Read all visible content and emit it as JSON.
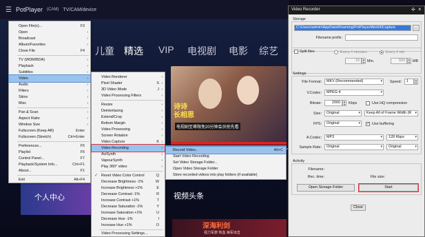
{
  "player": {
    "app_name": "PotPlayer",
    "menu_glyph": "☰",
    "cam_tag": "(CAM)",
    "device": "TV/CAM/device",
    "nav": [
      "儿童",
      "精选",
      "VIP",
      "电视剧",
      "电影",
      "综艺"
    ],
    "poster_title_line1": "诗诗",
    "poster_title_line2": "长相思",
    "poster_subtitle": "电视剧至尊限免20分钟会员抢先看",
    "personal_center": "个人中心",
    "video_headline": "视频头条",
    "promo_title": "深海利剑",
    "promo_subtitle": "强力军旅 热血 海军出击"
  },
  "main_menu": {
    "items": [
      {
        "label": "Open File(s)...",
        "shortcut": "F3"
      },
      {
        "label": "Open",
        "shortcut": "",
        "arrow": true
      },
      {
        "label": "Broadcast",
        "shortcut": "",
        "arrow": true
      },
      {
        "label": "Album/Favorites",
        "shortcut": "",
        "arrow": true
      },
      {
        "label": "Close File",
        "shortcut": "F4"
      },
      {
        "label": "TV (WDM/BDA)",
        "shortcut": "",
        "arrow": true
      },
      {
        "label": "Playback",
        "shortcut": "",
        "arrow": true
      },
      {
        "label": "Subtitles",
        "shortcut": "",
        "arrow": true
      },
      {
        "label": "Video",
        "shortcut": "",
        "arrow": true
      },
      {
        "label": "Audio",
        "shortcut": "",
        "arrow": true
      },
      {
        "label": "Filters",
        "shortcut": "",
        "arrow": true
      },
      {
        "label": "Skins",
        "shortcut": "",
        "arrow": true
      },
      {
        "label": "Misc",
        "shortcut": "",
        "arrow": true
      },
      {
        "label": "Pan & Scan",
        "shortcut": "",
        "arrow": true
      },
      {
        "label": "Aspect Ratio",
        "shortcut": "",
        "arrow": true
      },
      {
        "label": "Window Size",
        "shortcut": "",
        "arrow": true
      },
      {
        "label": "Fullscreen (Keep AR)",
        "shortcut": "Enter"
      },
      {
        "label": "Fullscreen (Stretch)",
        "shortcut": "Ctrl+Enter"
      },
      {
        "label": "Preferences...",
        "shortcut": "F5"
      },
      {
        "label": "Playlist",
        "shortcut": "F6"
      },
      {
        "label": "Control Panel...",
        "shortcut": "F7"
      },
      {
        "label": "Playback/System Info...",
        "shortcut": "Ctrl+F1"
      },
      {
        "label": "About...",
        "shortcut": "F1"
      },
      {
        "label": "Exit",
        "shortcut": "Alt+F4"
      }
    ]
  },
  "video_menu": {
    "items": [
      {
        "label": "Video Renderer",
        "shortcut": "",
        "arrow": true
      },
      {
        "label": "Pixel Shader",
        "shortcut": "S",
        "arrow": true
      },
      {
        "label": "3D Video Mode",
        "shortcut": "J",
        "arrow": true
      },
      {
        "label": "Video Processing Filters",
        "shortcut": "",
        "arrow": true
      },
      {
        "label": "Resize",
        "shortcut": "",
        "arrow": true
      },
      {
        "label": "Deinterlacing",
        "shortcut": "",
        "arrow": true
      },
      {
        "label": "Extend/Crop",
        "shortcut": "",
        "arrow": true
      },
      {
        "label": "Bottom Margin",
        "shortcut": "",
        "arrow": true
      },
      {
        "label": "Video Processing",
        "shortcut": "",
        "arrow": true
      },
      {
        "label": "Screen Rotation",
        "shortcut": "",
        "arrow": true
      },
      {
        "label": "Video Capture",
        "shortcut": "K",
        "arrow": true
      },
      {
        "label": "Video Recording",
        "shortcut": "",
        "arrow": true
      },
      {
        "label": "AviSynth",
        "shortcut": "",
        "arrow": true
      },
      {
        "label": "VapourSynth",
        "shortcut": "",
        "arrow": true
      },
      {
        "label": "Play 360° video",
        "shortcut": "",
        "arrow": true
      },
      {
        "label": "Reset Video Color Control",
        "shortcut": "Q"
      },
      {
        "label": "Decrease Brightness -1%",
        "shortcut": "W"
      },
      {
        "label": "Increase Brightness +1%",
        "shortcut": "E"
      },
      {
        "label": "Decrease Contrast -1%",
        "shortcut": "R"
      },
      {
        "label": "Increase Contrast +1%",
        "shortcut": "T"
      },
      {
        "label": "Decrease Saturation -1%",
        "shortcut": "Y"
      },
      {
        "label": "Increase Saturation +1%",
        "shortcut": "U"
      },
      {
        "label": "Decrease Hue -1%",
        "shortcut": "I"
      },
      {
        "label": "Increase Hue +1%",
        "shortcut": "O"
      },
      {
        "label": "Video Processing Settings...",
        "shortcut": ""
      }
    ]
  },
  "recording_menu": {
    "items": [
      {
        "label": "Record Video...",
        "shortcut": "Alt+C"
      },
      {
        "label": "Start Video Recording",
        "shortcut": ""
      },
      {
        "label": "Set Video Storage Folder...",
        "shortcut": ""
      },
      {
        "label": "Open Video Storage Folder",
        "shortcut": ""
      },
      {
        "label": "Store recorded videos into play folders (if available)",
        "shortcut": ""
      }
    ]
  },
  "recorder": {
    "title": "Video Recorder",
    "pin_glyph": "✢",
    "close_glyph": "×",
    "storage": {
      "group_label": "Storage",
      "path": "C:\\Users\\admin\\AppData\\Roaming\\PotPlayerMini64\\Capture",
      "browse_label": "...",
      "prefix_label": "Filename prefix:",
      "prefix_value": ""
    },
    "split": {
      "label": "Split files",
      "every_minutes": "Every # minutes",
      "every_mb": "Every # mb",
      "minutes_value": "10",
      "minutes_unit": "Min.",
      "mb_value": "500",
      "mb_unit": "MB"
    },
    "settings": {
      "group_label": "Settings",
      "file_format_label": "File Format:",
      "file_format_value": "MKV (Recommended)",
      "speed_label": "Speed:",
      "speed_value": "1",
      "vcodec_label": "V.Codec:",
      "vcodec_value": "MPEG-4",
      "bitrate_label": "Bitrate:",
      "bitrate_value": "2000",
      "bitrate_unit": "Kbps",
      "hq_label": "Use HQ compression",
      "size_label": "Size:",
      "size_value": "Original",
      "keep_frames_value": "Keep All of Frame Width (R",
      "fps_label": "FPS:",
      "fps_value": "Original",
      "buffering_label": "Use buffering",
      "acodec_label": "A.Codec:",
      "acodec_value": "MP3",
      "abitrate_value": "128 Kbps",
      "samplerate_label": "Sample Rate:",
      "samplerate_value": "Original",
      "channels_value": "Original"
    },
    "activity": {
      "group_label": "Activity",
      "filename_label": "Filename:",
      "rectime_label": "Rec. time:",
      "filesize_label": "File size:",
      "open_folder_label": "Open Storage Folder",
      "start_label": "Start"
    },
    "close_label": "Close"
  },
  "colors": {
    "menu_highlight": "#99c3ee",
    "annotation_red": "#e03030",
    "path_selection": "#3a78d6"
  }
}
